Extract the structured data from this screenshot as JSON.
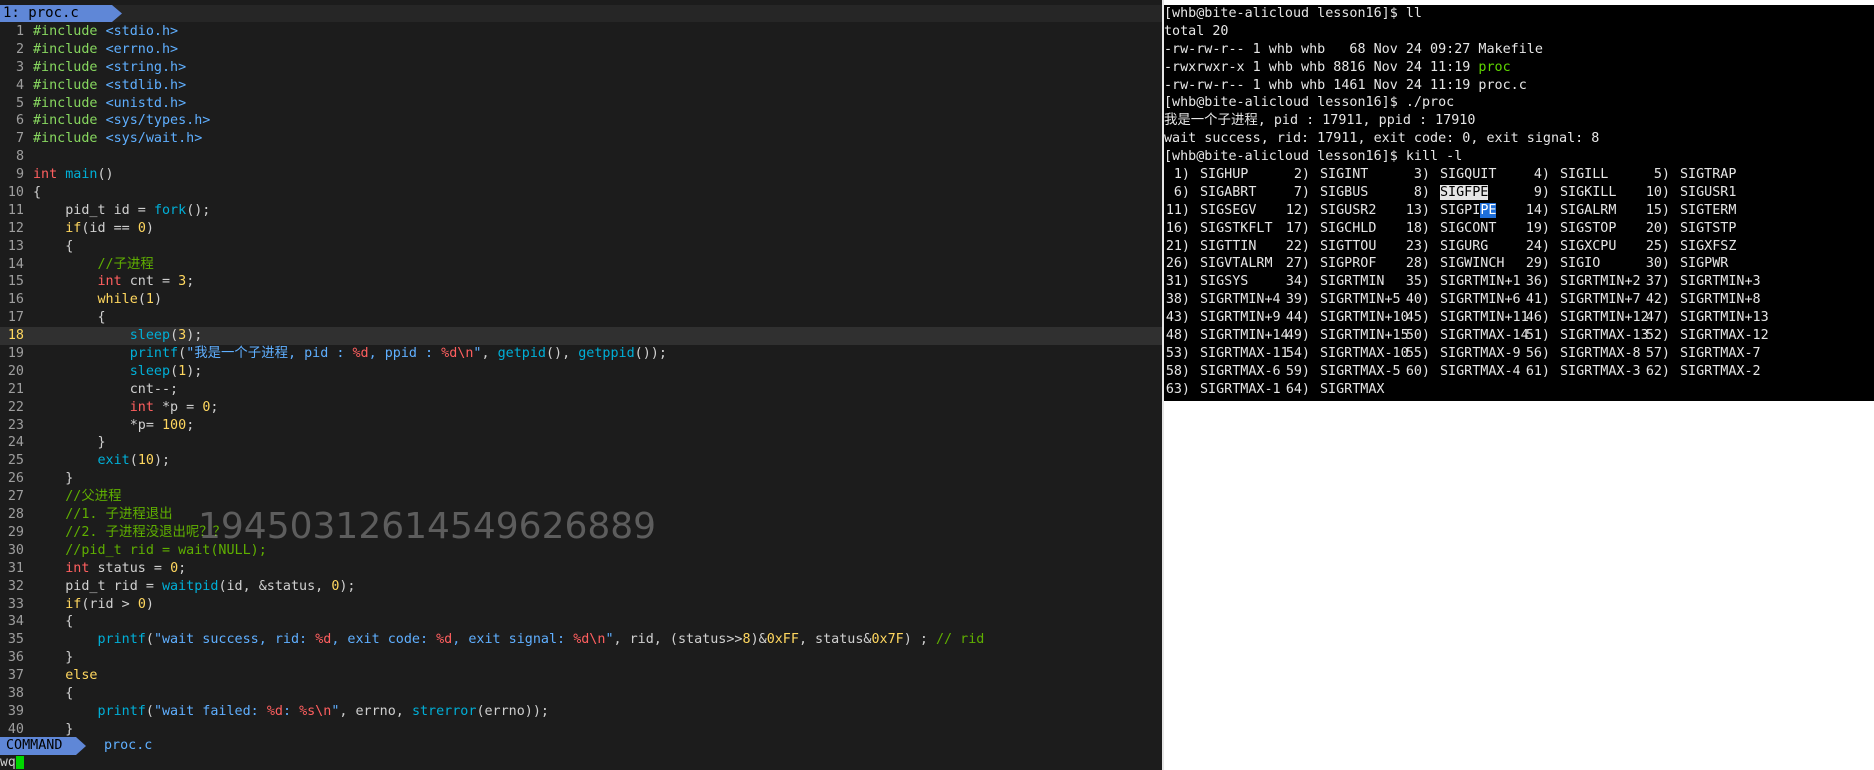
{
  "vim": {
    "tab_label": "1: proc.c",
    "mode": "COMMAND",
    "status_file": "proc.c",
    "cmdline": "wq",
    "current_line": 18,
    "lines": [
      [
        [
          "pp",
          "#include "
        ],
        [
          "inc",
          "<stdio.h>"
        ]
      ],
      [
        [
          "pp",
          "#include "
        ],
        [
          "inc",
          "<errno.h>"
        ]
      ],
      [
        [
          "pp",
          "#include "
        ],
        [
          "inc",
          "<string.h>"
        ]
      ],
      [
        [
          "pp",
          "#include "
        ],
        [
          "inc",
          "<stdlib.h>"
        ]
      ],
      [
        [
          "pp",
          "#include "
        ],
        [
          "inc",
          "<unistd.h>"
        ]
      ],
      [
        [
          "pp",
          "#include "
        ],
        [
          "inc",
          "<sys/types.h>"
        ]
      ],
      [
        [
          "pp",
          "#include "
        ],
        [
          "inc",
          "<sys/wait.h>"
        ]
      ],
      [],
      [
        [
          "kw",
          "int "
        ],
        [
          "fn",
          "main"
        ],
        [
          "",
          "()"
        ]
      ],
      [
        [
          "",
          "{"
        ]
      ],
      [
        [
          "",
          "    pid_t id = "
        ],
        [
          "fn",
          "fork"
        ],
        [
          "",
          "();"
        ]
      ],
      [
        [
          "ctl",
          "    if"
        ],
        [
          "",
          "(id == "
        ],
        [
          "num2",
          "0"
        ],
        [
          "",
          ")"
        ]
      ],
      [
        [
          "",
          "    {"
        ]
      ],
      [
        [
          "cm",
          "        //子进程"
        ]
      ],
      [
        [
          "kw",
          "        int "
        ],
        [
          "",
          "cnt = "
        ],
        [
          "num2",
          "3"
        ],
        [
          "",
          ";"
        ]
      ],
      [
        [
          "ctl",
          "        while"
        ],
        [
          "",
          "("
        ],
        [
          "num2",
          "1"
        ],
        [
          "",
          ")"
        ]
      ],
      [
        [
          "",
          "        {"
        ]
      ],
      [
        [
          "fn",
          "            sleep"
        ],
        [
          "",
          "("
        ],
        [
          "num2",
          "3"
        ],
        [
          "",
          ");"
        ]
      ],
      [
        [
          "fn",
          "            printf"
        ],
        [
          "",
          "("
        ],
        [
          "str",
          "\"我是一个子进程, pid : "
        ],
        [
          "esc",
          "%d"
        ],
        [
          "str",
          ", ppid : "
        ],
        [
          "esc",
          "%d\\n"
        ],
        [
          "str",
          "\""
        ],
        [
          "",
          ", "
        ],
        [
          "fn",
          "getpid"
        ],
        [
          "",
          "(), "
        ],
        [
          "fn",
          "getppid"
        ],
        [
          "",
          "());"
        ]
      ],
      [
        [
          "fn",
          "            sleep"
        ],
        [
          "",
          "("
        ],
        [
          "num2",
          "1"
        ],
        [
          "",
          ");"
        ]
      ],
      [
        [
          "",
          "            cnt--;"
        ]
      ],
      [
        [
          "kw",
          "            int "
        ],
        [
          "",
          "*p = "
        ],
        [
          "num2",
          "0"
        ],
        [
          "",
          ";"
        ]
      ],
      [
        [
          "",
          "            *p= "
        ],
        [
          "num2",
          "100"
        ],
        [
          "",
          ";"
        ]
      ],
      [
        [
          "",
          "        }"
        ]
      ],
      [
        [
          "fn",
          "        exit"
        ],
        [
          "",
          "("
        ],
        [
          "num2",
          "10"
        ],
        [
          "",
          ");"
        ]
      ],
      [
        [
          "",
          "    }"
        ]
      ],
      [
        [
          "cm",
          "    //父进程"
        ]
      ],
      [
        [
          "cm",
          "    //1. 子进程退出"
        ]
      ],
      [
        [
          "cm",
          "    //2. 子进程没退出呢？？"
        ]
      ],
      [
        [
          "cm",
          "    //pid_t rid = wait(NULL);"
        ]
      ],
      [
        [
          "kw",
          "    int "
        ],
        [
          "",
          "status = "
        ],
        [
          "num2",
          "0"
        ],
        [
          "",
          ";"
        ]
      ],
      [
        [
          "",
          "    pid_t rid = "
        ],
        [
          "fn",
          "waitpid"
        ],
        [
          "",
          "(id, &status, "
        ],
        [
          "num2",
          "0"
        ],
        [
          "",
          ");"
        ]
      ],
      [
        [
          "ctl",
          "    if"
        ],
        [
          "",
          "(rid > "
        ],
        [
          "num2",
          "0"
        ],
        [
          "",
          ")"
        ]
      ],
      [
        [
          "",
          "    {"
        ]
      ],
      [
        [
          "fn",
          "        printf"
        ],
        [
          "",
          "("
        ],
        [
          "str",
          "\"wait success, rid: "
        ],
        [
          "esc",
          "%d"
        ],
        [
          "str",
          ", exit code: "
        ],
        [
          "esc",
          "%d"
        ],
        [
          "str",
          ", exit signal: "
        ],
        [
          "esc",
          "%d\\n"
        ],
        [
          "str",
          "\""
        ],
        [
          "",
          ", rid, (status>>"
        ],
        [
          "num2",
          "8"
        ],
        [
          "",
          ")&"
        ],
        [
          "num2",
          "0xFF"
        ],
        [
          "",
          ", status&"
        ],
        [
          "num2",
          "0x7F"
        ],
        [
          "",
          ") ; "
        ],
        [
          "cm",
          "// rid"
        ]
      ],
      [
        [
          "",
          "    }"
        ]
      ],
      [
        [
          "ctl",
          "    else"
        ]
      ],
      [
        [
          "",
          "    {"
        ]
      ],
      [
        [
          "fn",
          "        printf"
        ],
        [
          "",
          "("
        ],
        [
          "str",
          "\"wait failed: "
        ],
        [
          "esc",
          "%d"
        ],
        [
          "str",
          ": "
        ],
        [
          "esc",
          "%s\\n"
        ],
        [
          "str",
          "\""
        ],
        [
          "",
          ", errno, "
        ],
        [
          "fn",
          "strerror"
        ],
        [
          "",
          "(errno));"
        ]
      ],
      [
        [
          "",
          "    }"
        ]
      ]
    ]
  },
  "watermark": "19450312614549626889",
  "terminal": {
    "lines": [
      [
        [
          "",
          "[whb@bite-alicloud lesson16]$ ll"
        ]
      ],
      [
        [
          "",
          "total 20"
        ]
      ],
      [
        [
          "",
          "-rw-rw-r-- 1 whb whb   68 Nov 24 09:27 Makefile"
        ]
      ],
      [
        [
          "",
          "-rwxrwxr-x 1 whb whb 8816 Nov 24 11:19 "
        ],
        [
          "green",
          "proc"
        ]
      ],
      [
        [
          "",
          "-rw-rw-r-- 1 whb whb 1461 Nov 24 11:19 proc.c"
        ]
      ],
      [
        [
          "",
          "[whb@bite-alicloud lesson16]$ ./proc"
        ]
      ],
      [
        [
          "",
          "我是一个子进程, pid : 17911, ppid : 17910"
        ]
      ],
      [
        [
          "",
          "wait success, rid: 17911, exit code: 0, exit signal: 8"
        ]
      ],
      [
        [
          "",
          "[whb@bite-alicloud lesson16]$ kill -l"
        ]
      ]
    ],
    "signals": [
      [
        "1",
        "SIGHUP"
      ],
      [
        "2",
        "SIGINT"
      ],
      [
        "3",
        "SIGQUIT"
      ],
      [
        "4",
        "SIGILL"
      ],
      [
        "5",
        "SIGTRAP"
      ],
      [
        "6",
        "SIGABRT"
      ],
      [
        "7",
        "SIGBUS"
      ],
      [
        "8",
        "SIGFPE"
      ],
      [
        "9",
        "SIGKILL"
      ],
      [
        "10",
        "SIGUSR1"
      ],
      [
        "11",
        "SIGSEGV"
      ],
      [
        "12",
        "SIGUSR2"
      ],
      [
        "13",
        "SIGPIPE"
      ],
      [
        "14",
        "SIGALRM"
      ],
      [
        "15",
        "SIGTERM"
      ],
      [
        "16",
        "SIGSTKFLT"
      ],
      [
        "17",
        "SIGCHLD"
      ],
      [
        "18",
        "SIGCONT"
      ],
      [
        "19",
        "SIGSTOP"
      ],
      [
        "20",
        "SIGTSTP"
      ],
      [
        "21",
        "SIGTTIN"
      ],
      [
        "22",
        "SIGTTOU"
      ],
      [
        "23",
        "SIGURG"
      ],
      [
        "24",
        "SIGXCPU"
      ],
      [
        "25",
        "SIGXFSZ"
      ],
      [
        "26",
        "SIGVTALRM"
      ],
      [
        "27",
        "SIGPROF"
      ],
      [
        "28",
        "SIGWINCH"
      ],
      [
        "29",
        "SIGIO"
      ],
      [
        "30",
        "SIGPWR"
      ],
      [
        "31",
        "SIGSYS"
      ],
      [
        "34",
        "SIGRTMIN"
      ],
      [
        "35",
        "SIGRTMIN+1"
      ],
      [
        "36",
        "SIGRTMIN+2"
      ],
      [
        "37",
        "SIGRTMIN+3"
      ],
      [
        "38",
        "SIGRTMIN+4"
      ],
      [
        "39",
        "SIGRTMIN+5"
      ],
      [
        "40",
        "SIGRTMIN+6"
      ],
      [
        "41",
        "SIGRTMIN+7"
      ],
      [
        "42",
        "SIGRTMIN+8"
      ],
      [
        "43",
        "SIGRTMIN+9"
      ],
      [
        "44",
        "SIGRTMIN+10"
      ],
      [
        "45",
        "SIGRTMIN+11"
      ],
      [
        "46",
        "SIGRTMIN+12"
      ],
      [
        "47",
        "SIGRTMIN+13"
      ],
      [
        "48",
        "SIGRTMIN+14"
      ],
      [
        "49",
        "SIGRTMIN+15"
      ],
      [
        "50",
        "SIGRTMAX-14"
      ],
      [
        "51",
        "SIGRTMAX-13"
      ],
      [
        "52",
        "SIGRTMAX-12"
      ],
      [
        "53",
        "SIGRTMAX-11"
      ],
      [
        "54",
        "SIGRTMAX-10"
      ],
      [
        "55",
        "SIGRTMAX-9"
      ],
      [
        "56",
        "SIGRTMAX-8"
      ],
      [
        "57",
        "SIGRTMAX-7"
      ],
      [
        "58",
        "SIGRTMAX-6"
      ],
      [
        "59",
        "SIGRTMAX-5"
      ],
      [
        "60",
        "SIGRTMAX-4"
      ],
      [
        "61",
        "SIGRTMAX-3"
      ],
      [
        "62",
        "SIGRTMAX-2"
      ],
      [
        "63",
        "SIGRTMAX-1"
      ],
      [
        "64",
        "SIGRTMAX"
      ]
    ],
    "selected_signal": "SIGFPE",
    "cursor_signal": "SIGPIPE"
  }
}
